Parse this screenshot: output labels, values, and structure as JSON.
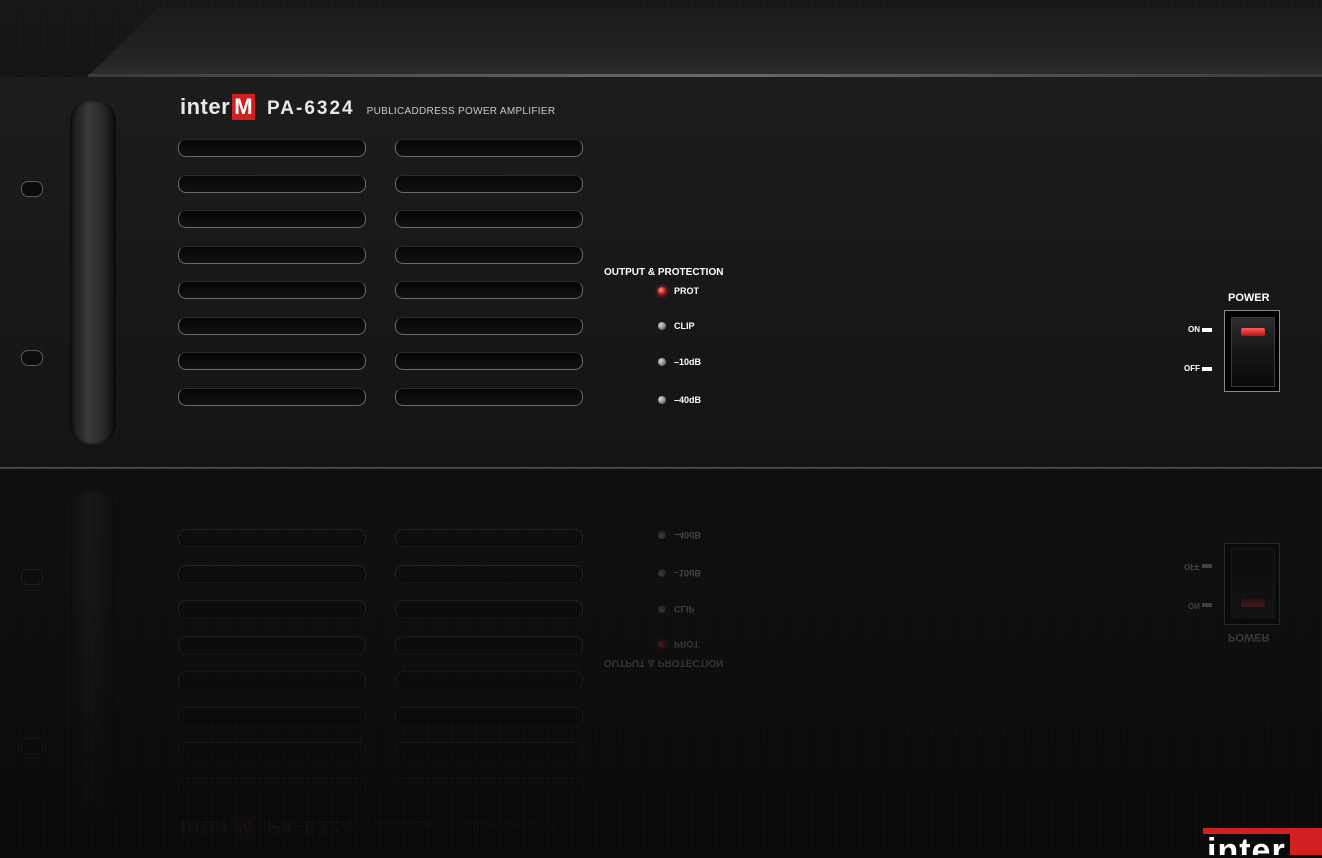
{
  "brand": {
    "logo_text": "inter",
    "logo_mark": "M",
    "model": "PA-6324",
    "description": "PUBLICADDRESS POWER AMPLIFIER",
    "accent_color": "#d0201f"
  },
  "indicators": {
    "title": "OUTPUT & PROTECTION",
    "items": [
      {
        "label": "PROT",
        "state": "on",
        "color": "#d21d1d"
      },
      {
        "label": "CLIP",
        "state": "off"
      },
      {
        "label": "–10dB",
        "state": "off"
      },
      {
        "label": "–40dB",
        "state": "off"
      }
    ]
  },
  "power": {
    "title": "POWER",
    "on_label": "ON",
    "off_label": "OFF",
    "state": "on"
  },
  "vents": {
    "columns": 2,
    "rows": 8
  },
  "corner_logo": {
    "text": "inter",
    "mark": "M"
  }
}
